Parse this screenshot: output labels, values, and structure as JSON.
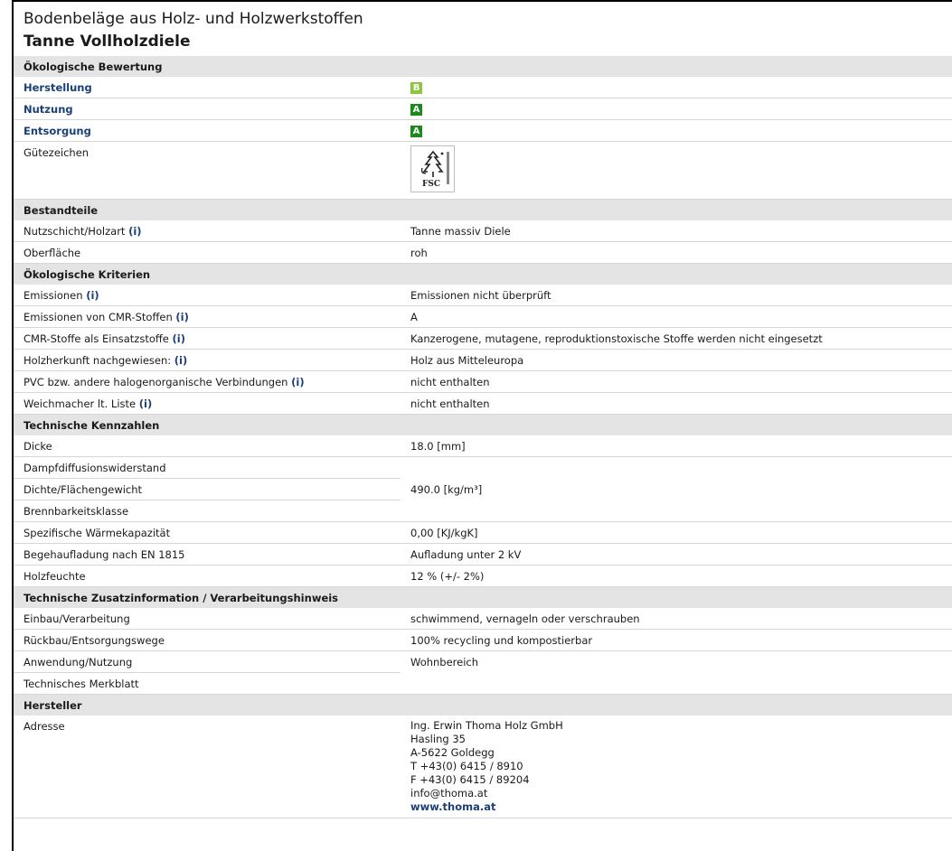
{
  "header": {
    "category": "Bodenbeläge aus Holz- und Holzwerkstoffen",
    "product": "Tanne Vollholzdiele"
  },
  "info_marker": "(i)",
  "eco_rating": {
    "title": "Ökologische Bewertung",
    "herstellung_label": "Herstellung",
    "herstellung_grade": "B",
    "nutzung_label": "Nutzung",
    "nutzung_grade": "A",
    "entsorgung_label": "Entsorgung",
    "entsorgung_grade": "A",
    "seal_label": "Gütezeichen",
    "seal_logo_text": "FSC"
  },
  "components": {
    "title": "Bestandteile",
    "layer_label": "Nutzschicht/Holzart",
    "layer_value": "Tanne massiv Diele",
    "surface_label": "Oberfläche",
    "surface_value": "roh"
  },
  "criteria": {
    "title": "Ökologische Kriterien",
    "emissions_label": "Emissionen",
    "emissions_value": "Emissionen nicht überprüft",
    "cmr_emissions_label": "Emissionen von CMR-Stoffen",
    "cmr_emissions_value": "A",
    "cmr_input_label": "CMR-Stoffe als Einsatzstoffe",
    "cmr_input_value": "Kanzerogene, mutagene, reproduktionstoxische Stoffe werden nicht eingesetzt",
    "wood_origin_label": "Holzherkunft nachgewiesen:",
    "wood_origin_value": "Holz aus Mitteleuropa",
    "pvc_label": "PVC bzw. andere halogenorganische Verbindungen",
    "pvc_value": "nicht enthalten",
    "plasticizer_label": "Weichmacher lt. Liste",
    "plasticizer_value": "nicht enthalten"
  },
  "technical": {
    "title": "Technische Kennzahlen",
    "thickness_label": "Dicke",
    "thickness_value": "18.0 [mm]",
    "vapor_label": "Dampfdiffusionswiderstand",
    "density_label": "Dichte/Flächengewicht",
    "density_value": "490.0 [kg/m³]",
    "fire_label": "Brennbarkeitsklasse",
    "heat_label": "Spezifische Wärmekapazität",
    "heat_value": "0,00 [KJ/kgK]",
    "charge_label": "Begehaufladung nach EN 1815",
    "charge_value": "Aufladung unter 2 kV",
    "moisture_label": "Holzfeuchte",
    "moisture_value": "12 % (+/- 2%)"
  },
  "additional": {
    "title": "Technische Zusatzinformation / Verarbeitungshinweis",
    "install_label": "Einbau/Verarbeitung",
    "install_value": "schwimmend, vernageln oder verschrauben",
    "disposal_label": "Rückbau/Entsorgungswege",
    "disposal_value": "100% recycling und kompostierbar",
    "usage_label": "Anwendung/Nutzung",
    "usage_value": "Wohnbereich",
    "datasheet_label": "Technisches Merkblatt"
  },
  "manufacturer": {
    "title": "Hersteller",
    "address_label": "Adresse",
    "name": "Ing. Erwin Thoma Holz GmbH",
    "street": "Hasling 35",
    "city": "A-5622 Goldegg",
    "phone": "T +43(0) 6415 / 8910",
    "fax": "F +43(0) 6415 / 89204",
    "email": "info@thoma.at",
    "website": "www.thoma.at"
  },
  "colors": {
    "link": "#1b3f78",
    "grade_b": "#8cc63f",
    "grade_a": "#1a8a1a",
    "section_bg": "#e4e4e4"
  }
}
